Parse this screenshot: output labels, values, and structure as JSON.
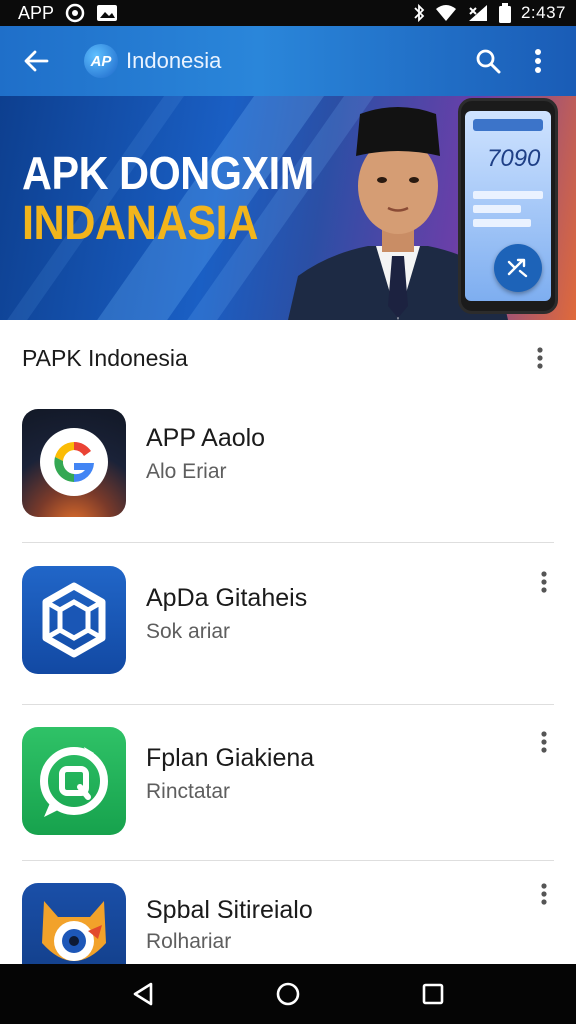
{
  "status_bar": {
    "carrier": "APP",
    "time": "2:437"
  },
  "app_bar": {
    "brand_logo_text": "AP",
    "brand_name": "Indonesia",
    "icons": [
      "back-arrow-icon",
      "search-icon",
      "more-vert-icon"
    ]
  },
  "banner": {
    "title_line1": "APK DONGXIM",
    "title_line2": "INDANASIA",
    "phone_number": "7090",
    "colors": {
      "title1": "#ffffff",
      "title2": "#f2b51c",
      "bg_start": "#0d3f8f",
      "bg_end": "#e06a3a"
    }
  },
  "section": {
    "title": "PAPK Indonesia"
  },
  "apps": [
    {
      "name": "APP Aaolo",
      "subtitle": "Alo Eriar",
      "icon": "google-g-icon"
    },
    {
      "name": "ApDa Gitaheis",
      "subtitle": "Sok ariar",
      "icon": "cube-network-icon"
    },
    {
      "name": "Fplan Giakiena",
      "subtitle": "Rinctatar",
      "icon": "chat-bubble-icon"
    },
    {
      "name": "Spbal Sitireialo",
      "subtitle": "Rolhariar",
      "icon": "fox-mascot-icon"
    }
  ],
  "nav_bar": {
    "icons": [
      "back-triangle-icon",
      "home-circle-icon",
      "recents-square-icon"
    ]
  },
  "colors": {
    "app_bar": "#2a86da",
    "accent": "#1d63b8",
    "divider": "#dedede"
  }
}
